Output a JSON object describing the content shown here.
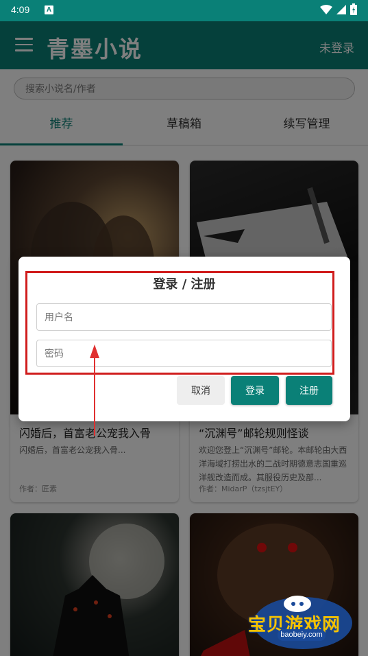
{
  "status_bar": {
    "time": "4:09"
  },
  "header": {
    "title": "青墨小说",
    "login_label": "未登录"
  },
  "search": {
    "placeholder": "搜索小说名/作者"
  },
  "tabs": [
    {
      "label": "推荐",
      "active": true
    },
    {
      "label": "草稿箱",
      "active": false
    },
    {
      "label": "续写管理",
      "active": false
    }
  ],
  "books": [
    {
      "title": "闪婚后，首富老公宠我入骨",
      "desc": "闪婚后，首富老公宠我入骨...",
      "author": "作者：匠素"
    },
    {
      "title": "“沉渊号”邮轮规则怪谈",
      "desc": "欢迎您登上“沉渊号”邮轮。本邮轮由大西洋海域打捞出水的二战时期德意志国重巡洋舰改造而成。其服役历史及部...",
      "author": "作者：MidarP（tzsjtEY）"
    }
  ],
  "dialog": {
    "title": "登录 / 注册",
    "username_placeholder": "用户名",
    "password_placeholder": "密码",
    "cancel_label": "取消",
    "login_label": "登录",
    "register_label": "注册"
  },
  "watermark": {
    "text": "宝贝游戏网",
    "url": "baobeiy.com"
  },
  "colors": {
    "primary": "#0a8077",
    "annotation": "#d01c1c"
  }
}
